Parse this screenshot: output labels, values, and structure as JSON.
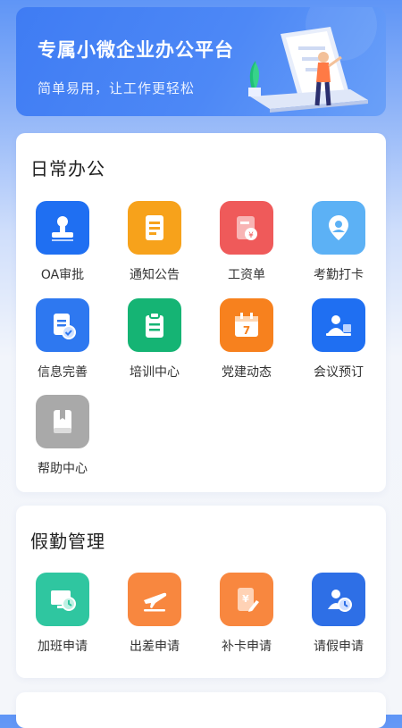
{
  "banner": {
    "title": "专属小微企业办公平台",
    "subtitle": "简单易用，让工作更轻松"
  },
  "sections": [
    {
      "title": "日常办公",
      "items": [
        {
          "label": "OA审批",
          "icon": "stamp-icon",
          "color": "#1f6ff2"
        },
        {
          "label": "通知公告",
          "icon": "notice-icon",
          "color": "#f7a21b"
        },
        {
          "label": "工资单",
          "icon": "salary-icon",
          "color": "#ef5a5a"
        },
        {
          "label": "考勤打卡",
          "icon": "location-icon",
          "color": "#5cb1f5"
        },
        {
          "label": "信息完善",
          "icon": "info-check-icon",
          "color": "#2e78f0"
        },
        {
          "label": "培训中心",
          "icon": "clipboard-icon",
          "color": "#15b474"
        },
        {
          "label": "党建动态",
          "icon": "calendar-icon",
          "color": "#f7811e"
        },
        {
          "label": "会议预订",
          "icon": "meeting-icon",
          "color": "#1f6ff2"
        },
        {
          "label": "帮助中心",
          "icon": "book-icon",
          "color": "#a9a9a9"
        }
      ]
    },
    {
      "title": "假勤管理",
      "items": [
        {
          "label": "加班申请",
          "icon": "overtime-icon",
          "color": "#2fc6a0"
        },
        {
          "label": "出差申请",
          "icon": "plane-icon",
          "color": "#f8873f"
        },
        {
          "label": "补卡申请",
          "icon": "card-edit-icon",
          "color": "#f8873f"
        },
        {
          "label": "请假申请",
          "icon": "leave-icon",
          "color": "#2e6fe6"
        }
      ]
    }
  ]
}
